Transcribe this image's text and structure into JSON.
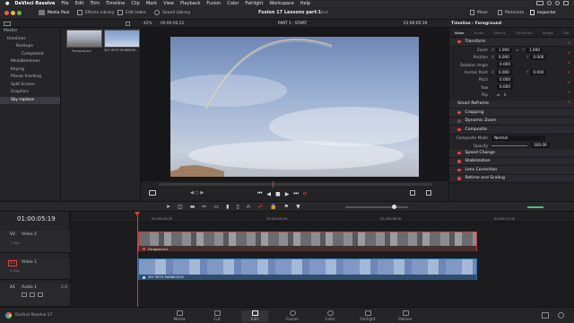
{
  "macbar": {
    "app": "DaVinci Resolve",
    "menus": [
      "File",
      "Edit",
      "Trim",
      "Timeline",
      "Clip",
      "Mark",
      "View",
      "Playback",
      "Fusion",
      "Color",
      "Fairlight",
      "Workspace",
      "Help"
    ]
  },
  "toolbar": {
    "media_pool": "Media Pool",
    "effects_library": "Effects Library",
    "edit_index": "Edit Index",
    "sound_library": "Sound Library",
    "project_title": "Fusion 17  Lessons part 1",
    "edited": "Edited",
    "mixer": "Mixer",
    "metadata": "Metadata",
    "inspector": "Inspector"
  },
  "viewer": {
    "zoom": "42%",
    "source_tc": "00:00:00:22",
    "timeline_name": "PART 1 - START",
    "record_tc": "01:00:05:19"
  },
  "bins": {
    "items": [
      "Master",
      "timelines",
      "Backups",
      "Completed timelines",
      "Media",
      "Keying",
      "Planar tracking",
      "Split Screen",
      "Graphics",
      "Sky replace"
    ],
    "selected": "Sky replace",
    "smart_bins": "Smart Bins",
    "keywords": "Keywords"
  },
  "clips": {
    "foreground": "Foreground",
    "sky": "SKY WITH RAINBOW..."
  },
  "inspector": {
    "header": "Timeline - Foreground",
    "tabs": [
      "Video",
      "Audio",
      "Effects",
      "Transition",
      "Image",
      "File"
    ],
    "transform": "Transform",
    "zoom_label": "Zoom",
    "zoom_x": "1.000",
    "zoom_y": "1.000",
    "position_label": "Position",
    "pos_x": "0.000",
    "pos_y": "0.000",
    "rotation_label": "Rotation Angle",
    "rotation": "0.000",
    "anchor_label": "Anchor Point",
    "anchor_x": "0.000",
    "anchor_y": "0.000",
    "pitch_label": "Pitch",
    "pitch": "0.000",
    "yaw_label": "Yaw",
    "yaw": "0.000",
    "flip_label": "Flip",
    "smart_reframe": "Smart Reframe",
    "cropping": "Cropping",
    "dynamic_zoom": "Dynamic Zoom",
    "composite": "Composite",
    "composite_mode_label": "Composite Mode",
    "composite_mode": "Normal",
    "opacity_label": "Opacity",
    "opacity": "100.00",
    "speed_change": "Speed Change",
    "stabilization": "Stabilization",
    "lens_correction": "Lens Correction",
    "retime_scaling": "Retime and Scaling"
  },
  "timeline": {
    "timecode": "01:00:05:19",
    "ruler": [
      "01:00:00:00",
      "01:00:04:00",
      "01:00:08:00",
      "01:00:12:00"
    ],
    "tracks": [
      {
        "id": "V2",
        "name": "Video 2",
        "clips": "1 Clip"
      },
      {
        "id": "V1",
        "name": "Video 1",
        "clips": "1 Clip"
      },
      {
        "id": "A1",
        "name": "Audio 1",
        "level": "2.0"
      }
    ],
    "fg_clip": "Foreground",
    "sky_clip": "SKY WITH RAINBOW.M"
  },
  "pagebar": {
    "app_label": "DaVinci Resolve 17",
    "pages": [
      "Media",
      "Cut",
      "Edit",
      "Fusion",
      "Color",
      "Fairlight",
      "Deliver"
    ],
    "active": "Edit"
  },
  "colors": {
    "accent_red": "#e2413b",
    "fg_clip_border": "#c23b3b",
    "sky_clip_bar": "#2d6fa3",
    "playhead": "#e23a30"
  }
}
